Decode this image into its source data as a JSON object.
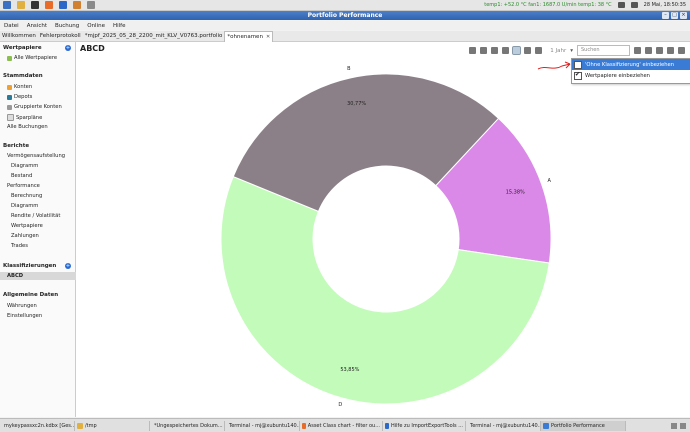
{
  "topbar": {
    "sensors": "temp1: +52.0 °C  fan1: 1687.0 U/min  temp1: 38 °C",
    "clock": "28 Mai, 18:50:35"
  },
  "window": {
    "title": "Portfolio Performance"
  },
  "menu": [
    "Datei",
    "Ansicht",
    "Buchung",
    "Online",
    "Hilfe"
  ],
  "tabs": [
    {
      "label": "Willkommen"
    },
    {
      "label": "Fehlerprotokoll"
    },
    {
      "label": "*mjpf_2025_05_28_2200_mit_KLV_V0763.portfolio"
    },
    {
      "label": "*ohnenamen",
      "active": true
    }
  ],
  "sidebar": {
    "wertpapiere_head": "Wertpapiere",
    "alle_wertpapiere": "Alle Wertpapiere",
    "stammdaten_head": "Stammdaten",
    "konten": "Konten",
    "depots": "Depots",
    "gruppierte_konten": "Gruppierte Konten",
    "sparplaene": "Sparpläne",
    "alle_buchungen": "Alle Buchungen",
    "berichte_head": "Berichte",
    "vermoegensaufstellung": "Vermögensaufstellung",
    "diagramm1": "Diagramm",
    "bestand": "Bestand",
    "performance": "Performance",
    "berechnung": "Berechnung",
    "diagramm2": "Diagramm",
    "rendite": "Rendite / Volatilität",
    "wertpapiere": "Wertpapiere",
    "zahlungen": "Zahlungen",
    "trades": "Trades",
    "klassifizierungen_head": "Klassifizierungen",
    "abcd": "ABCD",
    "allgemeine_head": "Allgemeine Daten",
    "waehrungen": "Währungen",
    "einstellungen": "Einstellungen"
  },
  "main": {
    "title": "ABCD",
    "year_label": "1 Jahr",
    "search_placeholder": "Suchen"
  },
  "dropdown": {
    "item1": "'Ohne Klassifizierung' einbeziehen",
    "item2": "Wertpapiere einbeziehen"
  },
  "chart_data": {
    "type": "pie",
    "donut": true,
    "slices": [
      {
        "label": "A",
        "value": 15.38,
        "display": "15,38%",
        "color": "#db89e8"
      },
      {
        "label": "D",
        "value": 53.85,
        "display": "53,85%",
        "color": "#c3fbba"
      },
      {
        "label": "B",
        "value": 30.77,
        "display": "30,77%",
        "color": "#8b8088"
      }
    ]
  },
  "taskbar": [
    {
      "label": "mykeypassxc2n.kdbx [Ges..."
    },
    {
      "label": "/tmp"
    },
    {
      "label": "*Ungespeichertes Dokum..."
    },
    {
      "label": "Terminal - mj@xubuntu140..."
    },
    {
      "label": "Asset Class chart - filter ou..."
    },
    {
      "label": "Hilfe zu ImportExportTools ..."
    },
    {
      "label": "Terminal - mj@xubuntu140..."
    },
    {
      "label": "Portfolio Performance",
      "active": true
    }
  ]
}
